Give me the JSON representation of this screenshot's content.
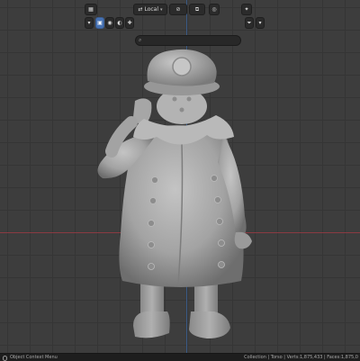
{
  "header": {
    "transform_orientation": "Local",
    "search": {
      "placeholder": ""
    }
  },
  "viewport": {
    "background": "#3d3d3d",
    "grid_color": "#353535",
    "x_axis_color": "#8a3a42",
    "y_axis_color": "#3a5a86",
    "object": "character-model"
  },
  "statusbar": {
    "left": "Object Context Menu",
    "right": "Collection | Torso | Verts:1,875,433 | Faces:1,875,0"
  },
  "colors": {
    "accent": "#4772b3",
    "model": "#a9a9a9"
  }
}
